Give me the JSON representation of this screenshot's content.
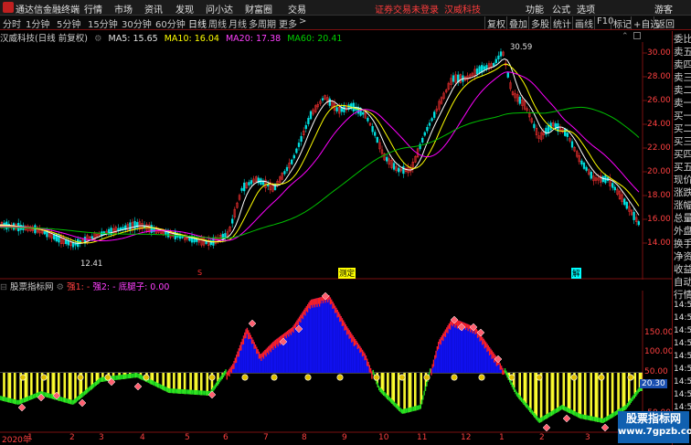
{
  "app": {
    "name": "通达信金融终端",
    "menu": [
      "行情",
      "市场",
      "资讯",
      "发现",
      "问小达",
      "财富圈",
      "交易"
    ],
    "login_notice": "证券交易未登录",
    "stock_short": "汉威科技",
    "right_menu": [
      "功能",
      "公式",
      "选项",
      "游客"
    ]
  },
  "toolbar": {
    "periods": [
      "分时",
      "1分钟",
      "5分钟",
      "15分钟",
      "30分钟",
      "60分钟",
      "日线",
      "周线",
      "月线",
      "多周期",
      "更多"
    ],
    "active_period": "日线",
    "more_arrow": ">",
    "buttons": [
      "复权",
      "叠加",
      "多股",
      "统计",
      "画线",
      "F10",
      "标记",
      "+自选",
      "返回"
    ]
  },
  "main_chart": {
    "title": "汉威科技(日线 前复权)",
    "ma5": "MA5: 15.65",
    "ma10": "MA10: 16.04",
    "ma20": "MA20: 17.38",
    "ma60": "MA60: 20.41",
    "high_label": "30.59",
    "low_label": "12.41",
    "y_ticks": [
      "30.00",
      "28.00",
      "26.00",
      "24.00",
      "22.00",
      "20.00",
      "18.00",
      "16.00",
      "14.00"
    ],
    "markers": [
      {
        "text": "S",
        "color": "#ff3030"
      },
      {
        "text": "测定",
        "color": "#ffff00"
      },
      {
        "text": "解",
        "color": "#00ffff"
      }
    ]
  },
  "indicator_panel": {
    "name": "股票指标网",
    "line1": "强1: -",
    "line2": "强2: -",
    "line3": "底腿子: 0.00",
    "y_ticks": [
      "150.00",
      "100.00",
      "50.00",
      "-50.00"
    ],
    "current_value": "20.30"
  },
  "x_axis": [
    "2020年",
    "1",
    "2",
    "3",
    "4",
    "5",
    "6",
    "7",
    "8",
    "9",
    "10",
    "11",
    "12",
    "1",
    "2",
    "3"
  ],
  "right_panel": [
    "委比",
    "卖五",
    "卖四",
    "卖三",
    "卖二",
    "卖一",
    "买一",
    "买二",
    "买三",
    "买四",
    "买五",
    "现价",
    "涨跌",
    "涨幅",
    "总量",
    "外盘",
    "换手",
    "净资",
    "收益",
    "自动",
    "行情",
    "14:56",
    "14:56",
    "14:56",
    "14:56",
    "14:56",
    "14:56",
    "14:56",
    "14:56",
    "14:56"
  ],
  "watermark": {
    "line1": "股票指标网",
    "line2": "www.7gpzb.com"
  },
  "colors": {
    "up": "#ff3232",
    "down": "#00e0e0",
    "ma5": "#ffffff",
    "ma10": "#ffff00",
    "ma20": "#ff00ff",
    "ma60": "#00c000",
    "axis": "#7a1010"
  }
}
